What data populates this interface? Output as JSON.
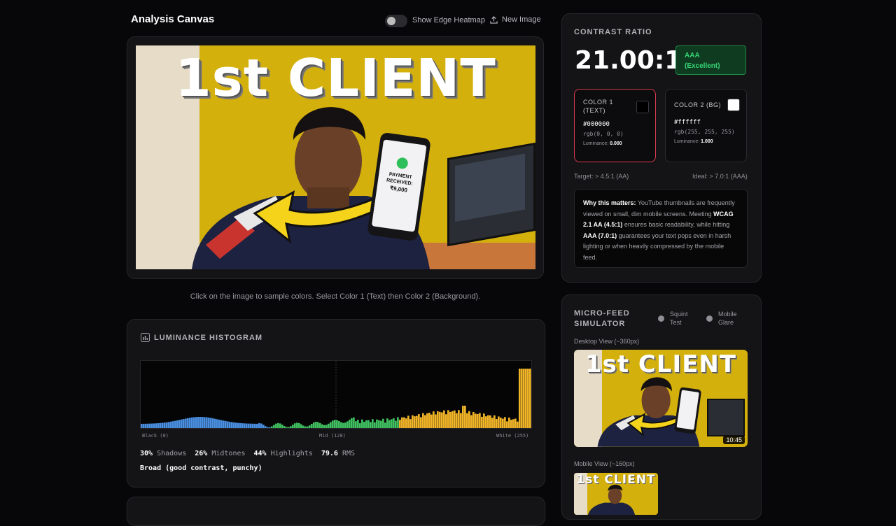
{
  "canvas": {
    "title": "Analysis Canvas",
    "edge_heatmap_label": "Show Edge Heatmap",
    "new_image_label": "New Image",
    "edge_heatmap_on": false,
    "thumbnail_headline": "1st CLIENT",
    "phone_text_1": "PAYMENT",
    "phone_text_2": "RECEIVED:",
    "phone_amount": "₹9,000",
    "instructions": "Click on the image to sample colors. Select Color 1 (Text) then Color 2 (Background)."
  },
  "histogram": {
    "title": "LUMINANCE HISTOGRAM",
    "axis": {
      "left": "Black (0)",
      "mid": "Mid (128)",
      "right": "White (255)"
    },
    "stats": [
      {
        "value": "30%",
        "label": "Shadows"
      },
      {
        "value": "26%",
        "label": "Midtones"
      },
      {
        "value": "44%",
        "label": "Highlights"
      },
      {
        "value": "79.6",
        "label": "RMS"
      }
    ],
    "verdict": "Broad (good contrast, punchy)",
    "colors": {
      "shadows": "#4a90e2",
      "midtones": "#3fbf5f",
      "highlights": "#f0b428"
    }
  },
  "contrast": {
    "title": "CONTRAST RATIO",
    "ratio": "21.00:1",
    "rating_level": "AAA",
    "rating_desc": "(Excellent)",
    "color1": {
      "label_1": "COLOR 1",
      "label_2": "(TEXT)",
      "hex": "#000000",
      "rgb": "rgb(0, 0, 0)",
      "lum_label": "Luminance:",
      "lum_value": "0.000",
      "swatch": "#000000"
    },
    "color2": {
      "label": "COLOR 2 (BG)",
      "hex": "#ffffff",
      "rgb": "rgb(255, 255, 255)",
      "lum_label": "Luminance:",
      "lum_value": "1.000",
      "swatch": "#ffffff"
    },
    "target": "Target: > 4.5:1 (AA)",
    "ideal": "Ideal: > 7.0:1 (AAA)",
    "why": {
      "lead": "Why this matters:",
      "t1": " YouTube thumbnails are frequently viewed on small, dim mobile screens. Meeting ",
      "b1": "WCAG 2.1 AA (4.5:1)",
      "t2": " ensures basic readability, while hitting ",
      "b2": "AAA (7.0:1)",
      "t3": " guarantees your text pops even in harsh lighting or when heavily compressed by the mobile feed."
    }
  },
  "microfeed": {
    "title_1": "MICRO-FEED",
    "title_2": "SIMULATOR",
    "squint_1": "Squint",
    "squint_2": "Test",
    "glare_1": "Mobile",
    "glare_2": "Glare",
    "desktop_label": "Desktop View (~360px)",
    "mobile_label": "Mobile View (~160px)",
    "duration": "10:45"
  },
  "icons": [
    "toggle-switch",
    "upload-icon",
    "bar-chart-icon",
    "radio-icon"
  ]
}
